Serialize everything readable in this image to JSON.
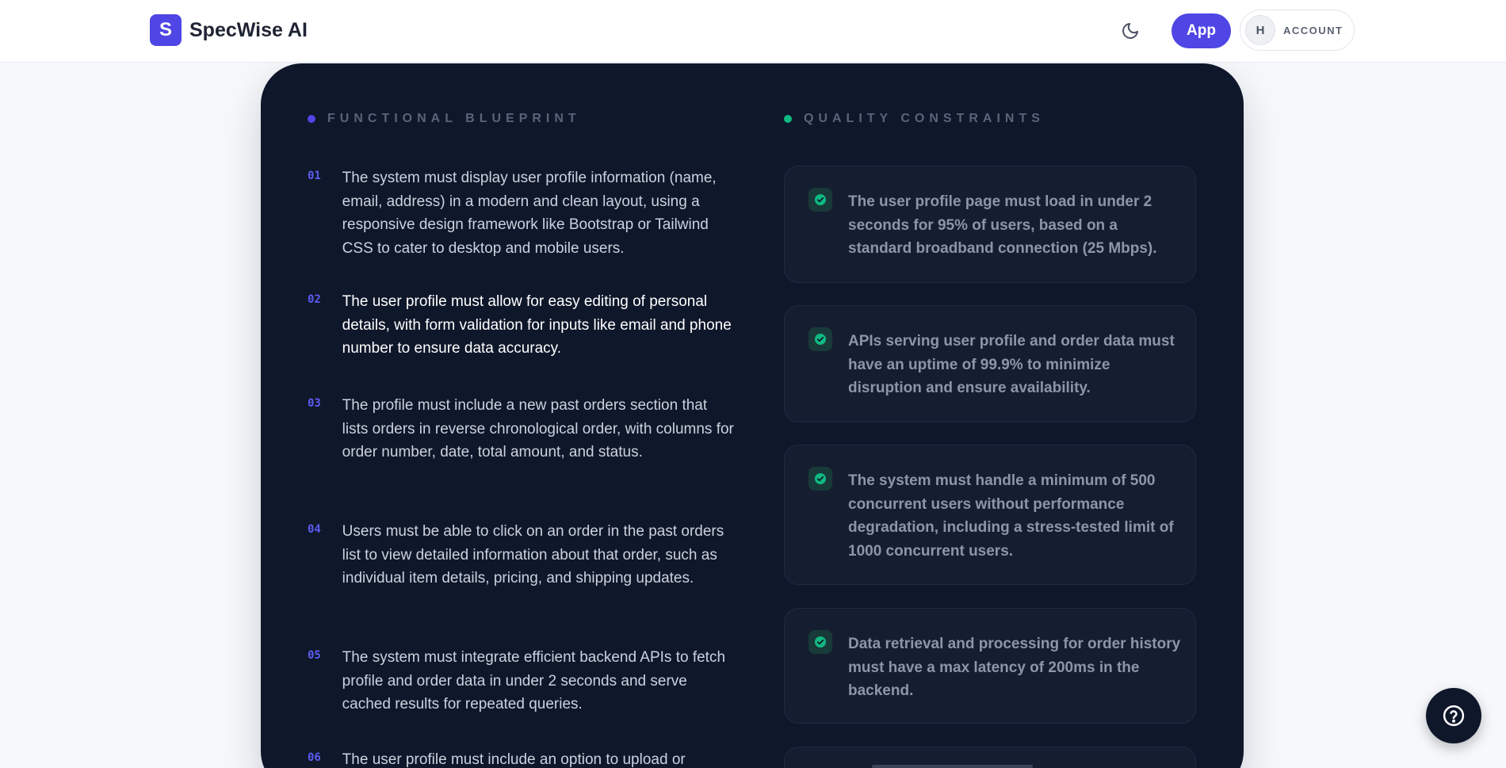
{
  "header": {
    "logo_letter": "S",
    "brand_name": "SpecWise AI",
    "theme_toggle_icon": "moon-icon",
    "app_button": "App",
    "account_initial": "H",
    "account_label": "ACCOUNT"
  },
  "functional": {
    "title": "FUNCTIONAL BLUEPRINT",
    "dot_color": "#4f46e5",
    "items": [
      {
        "num": "01",
        "text": "The system must display user profile information (name, email, address) in a modern and clean layout, using a responsive design framework like Bootstrap or Tailwind CSS to cater to desktop and mobile users."
      },
      {
        "num": "02",
        "text": "The user profile must allow for easy editing of personal details, with form validation for inputs like email and phone number to ensure data accuracy."
      },
      {
        "num": "03",
        "text": "The profile must include a new past orders section that lists orders in reverse chronological order, with columns for order number, date, total amount, and status."
      },
      {
        "num": "04",
        "text": "Users must be able to click on an order in the past orders list to view detailed information about that order, such as individual item details, pricing, and shipping updates."
      },
      {
        "num": "05",
        "text": "The system must integrate efficient backend APIs to fetch profile and order data in under 2 seconds and serve cached results for repeated queries."
      },
      {
        "num": "06",
        "text": "The user profile must include an option to upload or"
      }
    ]
  },
  "quality": {
    "title": "QUALITY CONSTRAINTS",
    "dot_color": "#10b981",
    "check_icon": "check-circle-icon",
    "items": [
      {
        "text": "The user profile page must load in under 2 seconds for 95% of users, based on a standard broadband connection (25 Mbps)."
      },
      {
        "text": "APIs serving user profile and order data must have an uptime of 99.9% to minimize disruption and ensure availability."
      },
      {
        "text": "The system must handle a minimum of 500 concurrent users without performance degradation, including a stress-tested limit of 1000 concurrent users."
      },
      {
        "text": "Data retrieval and processing for order history must have a max latency of 200ms in the backend."
      }
    ]
  },
  "help_button_icon": "help-icon"
}
